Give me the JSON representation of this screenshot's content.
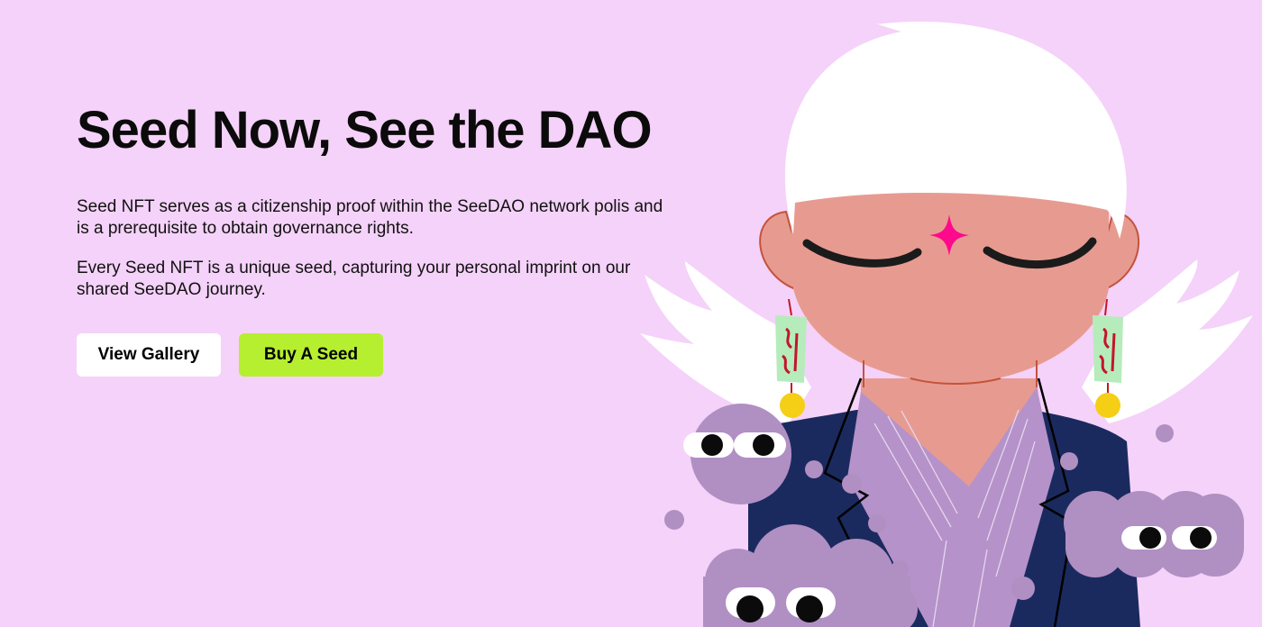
{
  "hero": {
    "title": "Seed Now, See the DAO",
    "paragraph_1": "Seed NFT serves as a citizenship proof within the SeeDAO network polis and is a prerequisite to obtain governance rights.",
    "paragraph_2": "Every Seed NFT is a unique seed, capturing your personal imprint on our shared SeeDAO journey.",
    "buttons": {
      "view_gallery": "View Gallery",
      "buy_seed": "Buy A Seed"
    }
  },
  "colors": {
    "background": "#f5d2f9",
    "view_gallery_bg": "#ffffff",
    "buy_seed_bg": "#b6ef2f",
    "hair": "#ffffff",
    "skin": "#e79b90",
    "forehead_star": "#ff0a8c",
    "robe": "#1b2a5e",
    "robe_inner": "#b592c9",
    "blob": "#b08fc3",
    "earring_bell": "#f4cf16",
    "earring_tag": "#b6ecbb"
  },
  "illustration": {
    "subject": "character with white bob hair, closed eyes, star mark, robe, wings, earrings and purple blob creatures"
  }
}
